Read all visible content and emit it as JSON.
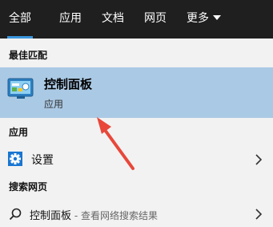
{
  "tabs": [
    {
      "label": "全部",
      "active": true
    },
    {
      "label": "应用"
    },
    {
      "label": "文档"
    },
    {
      "label": "网页"
    },
    {
      "label": "更多"
    }
  ],
  "best_match": {
    "heading": "最佳匹配",
    "title": "控制面板",
    "subtitle": "应用"
  },
  "apps": {
    "heading": "应用",
    "items": [
      {
        "label": "设置"
      }
    ]
  },
  "web": {
    "heading": "搜索网页",
    "query": "控制面板",
    "suffix": " - 查看网络搜索结果"
  },
  "icons": {
    "best_match": "control-panel-icon",
    "settings": "gear-icon",
    "web": "search-icon",
    "more": "chevron-down-icon",
    "open": "chevron-right-icon"
  },
  "colors": {
    "topbar": "#1f1f1f",
    "accent": "#3a96dd",
    "selected_bg": "#aac9e4",
    "background": "#f2f2f2",
    "arrow": "#e8473a"
  }
}
